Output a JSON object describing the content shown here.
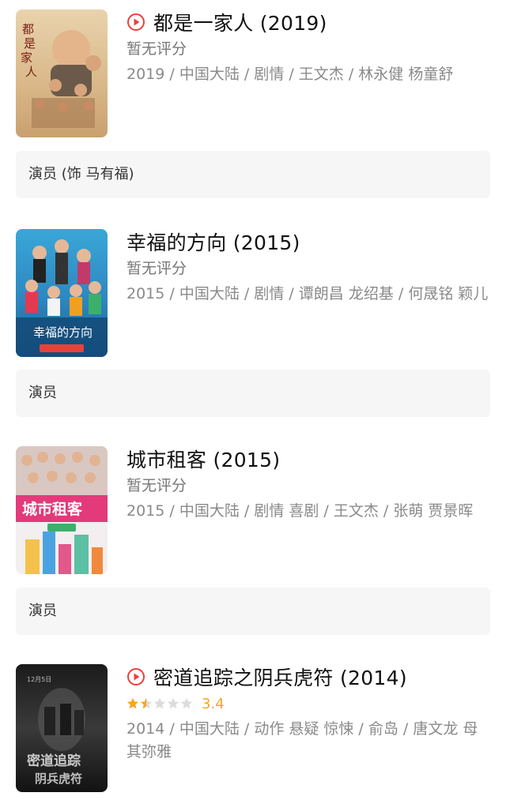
{
  "movies": [
    {
      "title": "都是一家人 (2019)",
      "has_play": true,
      "rating_text": "暂无评分",
      "meta": "2019 / 中国大陆 / 剧情 / 王文杰 / 林永健 杨童舒",
      "role": "演员 (饰 马有福)",
      "poster_text": "都是一家人"
    },
    {
      "title": "幸福的方向 (2015)",
      "has_play": false,
      "rating_text": "暂无评分",
      "meta": "2015 / 中国大陆 / 剧情 / 谭朗昌 龙绍基 / 何晟铭 颖儿",
      "role": "演员",
      "poster_text": "幸福的方向"
    },
    {
      "title": "城市租客 (2015)",
      "has_play": false,
      "rating_text": "暂无评分",
      "meta": "2015 / 中国大陆 / 剧情 喜剧 / 王文杰 / 张萌 贾景晖",
      "role": "演员",
      "poster_text": "城市租客"
    },
    {
      "title": "密道追踪之阴兵虎符 (2014)",
      "has_play": true,
      "rating_value": "3.4",
      "rating_stars": 1.5,
      "meta": "2014 / 中国大陆 / 动作 悬疑 惊悚 / 俞岛 / 唐文龙 母其弥雅",
      "poster_text": "密道追踪 阴兵虎符"
    }
  ],
  "colors": {
    "play_icon": "#e8413b",
    "star_filled": "#f5a623",
    "star_empty": "#dcdcdc",
    "meta_text": "#8a8a8a",
    "role_bg": "#f6f6f6"
  }
}
